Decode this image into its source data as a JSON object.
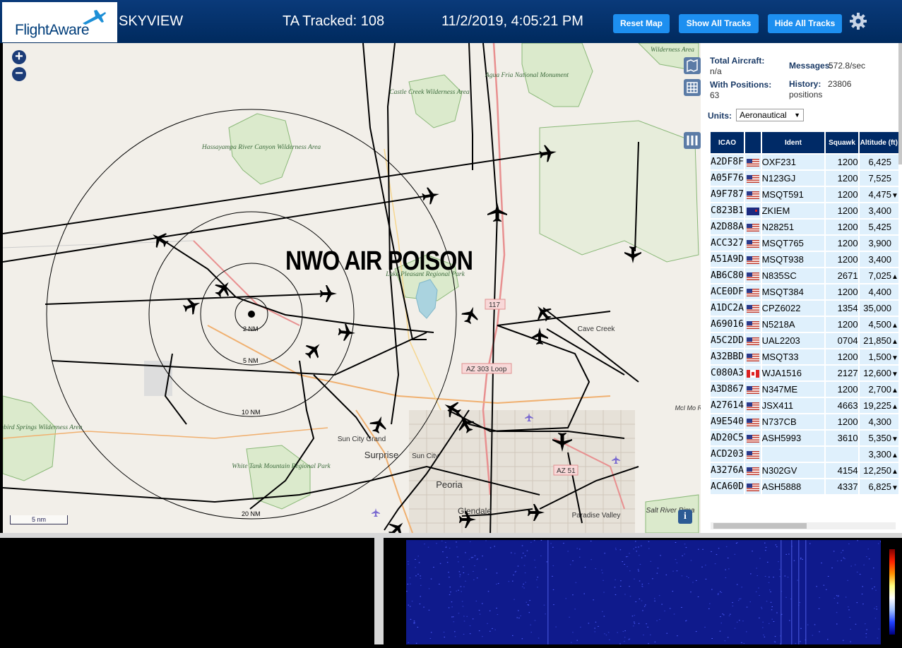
{
  "header": {
    "logo_text": "FlightAware",
    "app_name": "SKYVIEW",
    "tracked_label": "TA Tracked: 108",
    "datetime": "11/2/2019, 4:05:21 PM",
    "reset_map_label": "Reset Map",
    "show_all_label": "Show All Tracks",
    "hide_all_label": "Hide All Tracks"
  },
  "map": {
    "overlay_text": "NWO AIR POISON",
    "zoom_in": "+",
    "zoom_out": "−",
    "scale_label": "5 nm",
    "info_label": "i",
    "range_labels": [
      "2 NM",
      "5 NM",
      "10 NM",
      "20 NM"
    ],
    "places": [
      "Castle Creek Wilderness Area",
      "Hassayampa River Canyon Wilderness Area",
      "Agua Fria National Monument",
      "Lake Pleasant Regional Park",
      "Cave Creek",
      "Hummingbird Springs Wilderness Area",
      "White Tank Mountain Regional Park",
      "Sun City Grand",
      "Surprise",
      "Sun City",
      "Peoria",
      "Glendale",
      "Paradise Valley",
      "Salt River Pima",
      "Wilderness Area",
      "McI Mo R P"
    ],
    "road_shields": [
      "117",
      "AZ 303 Loop",
      "AZ 51"
    ]
  },
  "stats": {
    "total_aircraft_label": "Total Aircraft:",
    "total_aircraft_value": "n/a",
    "with_positions_label": "With Positions:",
    "with_positions_value": "63",
    "messages_label": "Messages:",
    "messages_value": "572.8/sec",
    "history_label": "History:",
    "history_value": "23806",
    "history_unit": "positions",
    "units_label": "Units:",
    "units_value": "Aeronautical"
  },
  "table": {
    "headers": [
      "ICAO",
      "",
      "Ident",
      "Squawk",
      "Altitude (ft)"
    ],
    "rows": [
      {
        "icao": "A2DF8F",
        "flag": "us",
        "ident": "OXF231",
        "squawk": "1200",
        "alt": "6,425",
        "trend": ""
      },
      {
        "icao": "A05F76",
        "flag": "us",
        "ident": "N123GJ",
        "squawk": "1200",
        "alt": "7,525",
        "trend": ""
      },
      {
        "icao": "A9F787",
        "flag": "us",
        "ident": "MSQT591",
        "squawk": "1200",
        "alt": "4,475",
        "trend": "▼"
      },
      {
        "icao": "C823B1",
        "flag": "nz",
        "ident": "ZKIEM",
        "squawk": "1200",
        "alt": "3,400",
        "trend": ""
      },
      {
        "icao": "A2D88A",
        "flag": "us",
        "ident": "N28251",
        "squawk": "1200",
        "alt": "5,425",
        "trend": ""
      },
      {
        "icao": "ACC327",
        "flag": "us",
        "ident": "MSQT765",
        "squawk": "1200",
        "alt": "3,900",
        "trend": ""
      },
      {
        "icao": "A51A9D",
        "flag": "us",
        "ident": "MSQT938",
        "squawk": "1200",
        "alt": "3,400",
        "trend": ""
      },
      {
        "icao": "AB6C80",
        "flag": "us",
        "ident": "N835SC",
        "squawk": "2671",
        "alt": "7,025",
        "trend": "▲"
      },
      {
        "icao": "ACE0DF",
        "flag": "us",
        "ident": "MSQT384",
        "squawk": "1200",
        "alt": "4,400",
        "trend": ""
      },
      {
        "icao": "A1DC2A",
        "flag": "us",
        "ident": "CPZ6022",
        "squawk": "1354",
        "alt": "35,000",
        "trend": ""
      },
      {
        "icao": "A69016",
        "flag": "us",
        "ident": "N5218A",
        "squawk": "1200",
        "alt": "4,500",
        "trend": "▲"
      },
      {
        "icao": "A5C2DD",
        "flag": "us",
        "ident": "UAL2203",
        "squawk": "0704",
        "alt": "21,850",
        "trend": "▲"
      },
      {
        "icao": "A32BBD",
        "flag": "us",
        "ident": "MSQT33",
        "squawk": "1200",
        "alt": "1,500",
        "trend": "▼"
      },
      {
        "icao": "C080A3",
        "flag": "ca",
        "ident": "WJA1516",
        "squawk": "2127",
        "alt": "12,600",
        "trend": "▼"
      },
      {
        "icao": "A3D867",
        "flag": "us",
        "ident": "N347ME",
        "squawk": "1200",
        "alt": "2,700",
        "trend": "▲"
      },
      {
        "icao": "A27614",
        "flag": "us",
        "ident": "JSX411",
        "squawk": "4663",
        "alt": "19,225",
        "trend": "▲"
      },
      {
        "icao": "A9E540",
        "flag": "us",
        "ident": "N737CB",
        "squawk": "1200",
        "alt": "4,300",
        "trend": ""
      },
      {
        "icao": "AD20C5",
        "flag": "us",
        "ident": "ASH5993",
        "squawk": "3610",
        "alt": "5,350",
        "trend": "▼"
      },
      {
        "icao": "ACD203",
        "flag": "us",
        "ident": "",
        "squawk": "",
        "alt": "3,300",
        "trend": "▲"
      },
      {
        "icao": "A3276A",
        "flag": "us",
        "ident": "N302GV",
        "squawk": "4154",
        "alt": "12,250",
        "trend": "▲"
      },
      {
        "icao": "ACA60D",
        "flag": "us",
        "ident": "ASH5888",
        "squawk": "4337",
        "alt": "6,825",
        "trend": "▼"
      }
    ]
  },
  "colors": {
    "header_bg": "#002a5e",
    "button_bg": "#1d8ff0",
    "table_header_bg": "#002a66",
    "table_row_bg": "#dff0fc",
    "waterfall_bg": "#0f1a8c"
  }
}
